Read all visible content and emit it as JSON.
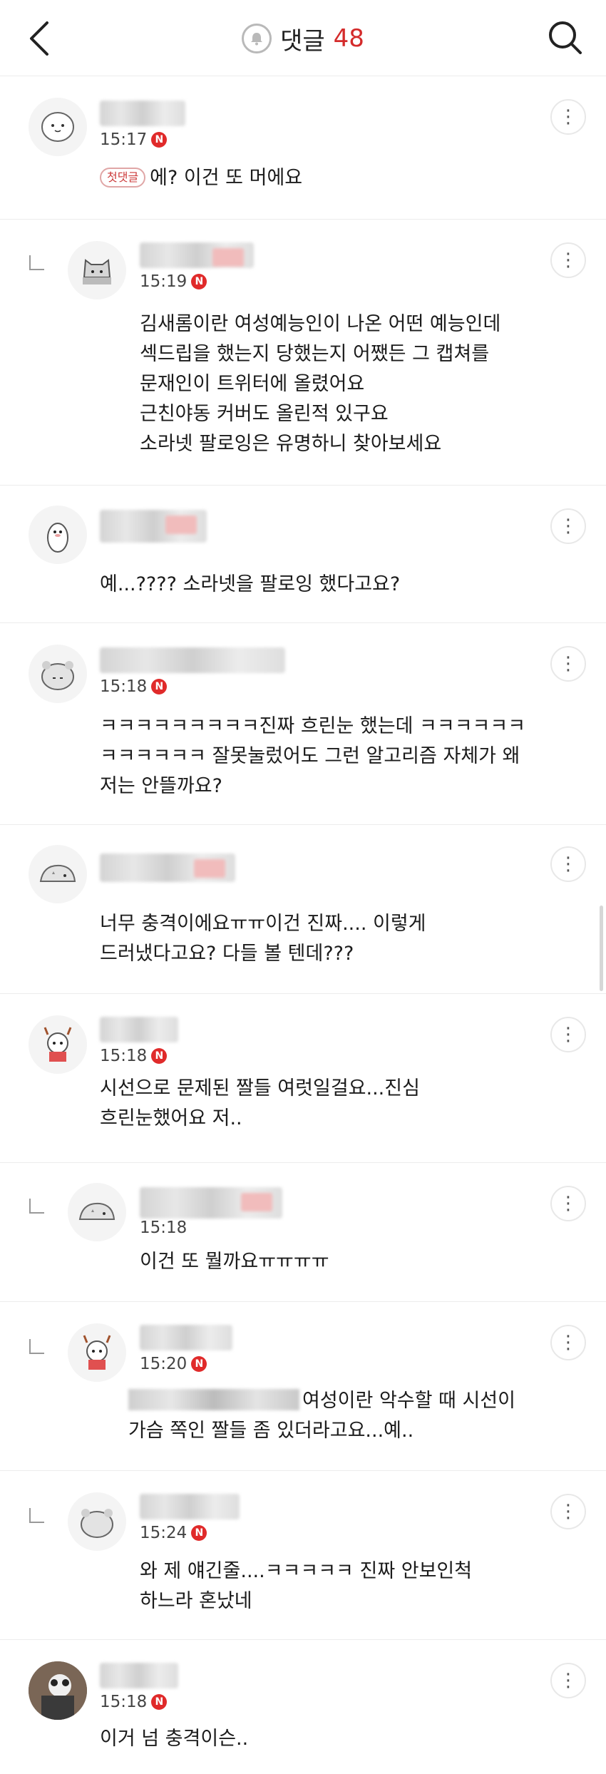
{
  "header": {
    "title": "댓글",
    "count": "48"
  },
  "colors": {
    "accent": "#d42b2b",
    "badge": "#e02a2a",
    "divider": "#ececec"
  },
  "icons": {
    "back": "chevron-left-icon",
    "bell": "bell-icon",
    "search": "search-icon",
    "more": "more-vertical-icon",
    "new": "new-badge-icon",
    "reply": "reply-arrow-icon"
  },
  "comments": [
    {
      "time": "15:17",
      "first_badge": "첫댓글",
      "text": "에? 이건 또 머에요"
    },
    {
      "time": "15:19",
      "text": "김새롬이란 여성예능인이 나온 어떤 예능인데\n섹드립을 했는지 당했는지 어쨌든 그 캡쳐를\n문재인이 트위터에 올렸어요\n근친야동 커버도 올린적 있구요\n소라넷 팔로잉은 유명하니 찾아보세요"
    },
    {
      "time": "",
      "text": "예...???? 소라넷을 팔로잉 했다고요?"
    },
    {
      "time": "15:18",
      "text": "ㅋㅋㅋㅋㅋㅋㅋㅋㅋ진짜 흐린눈 했는데 ㅋㅋㅋㅋㅋㅋ\nㅋㅋㅋㅋㅋㅋ 잘못눌렀어도 그런 알고리즘 자체가 왜\n저는 안뜰까요?"
    },
    {
      "time": "",
      "text": "너무 충격이에요ㅠㅠ이건 진짜.... 이렇게\n드러냈다고요? 다들 볼 텐데???"
    },
    {
      "time": "15:18",
      "text": "시선으로 문제된 짤들 여럿일걸요...진심\n흐린눈했어요 저.."
    },
    {
      "time": "15:18",
      "text": "이건 또 뭘까요ㅠㅠㅠㅠ"
    },
    {
      "time": "15:20",
      "text": "여성이란 악수할 때 시선이\n가슴 쪽인 짤들 좀 있더라고요...예.."
    },
    {
      "time": "15:24",
      "text": "와 제 얘긴줄....ㅋㅋㅋㅋㅋ 진짜 안보인척\n하느라 혼났네"
    },
    {
      "time": "15:18",
      "text": "이거 넘 충격이슨.."
    }
  ]
}
